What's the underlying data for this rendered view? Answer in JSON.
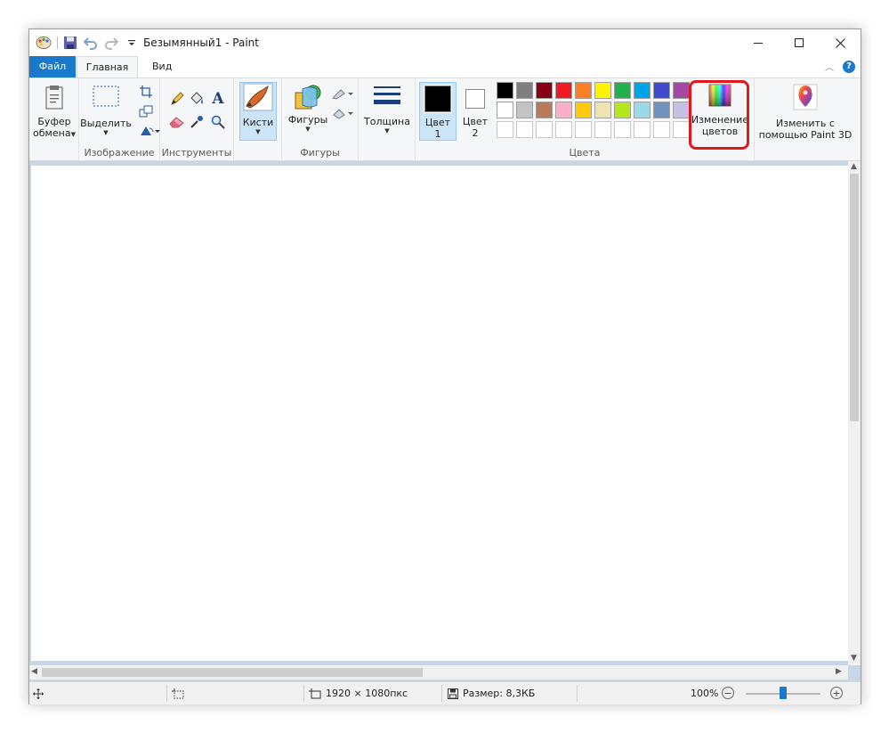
{
  "window": {
    "title": "Безымянный1 - Paint"
  },
  "tabs": {
    "file": "Файл",
    "home": "Главная",
    "view": "Вид"
  },
  "ribbon": {
    "clipboard": {
      "line1": "Буфер",
      "line2": "обмена"
    },
    "image": {
      "select_label": "Выделить",
      "group_label": "Изображение"
    },
    "tools": {
      "group_label": "Инструменты"
    },
    "brushes": {
      "label": "Кисти"
    },
    "shapes": {
      "label": "Фигуры",
      "group_label": "Фигуры"
    },
    "thickness": {
      "label": "Толщина"
    },
    "colors": {
      "color1_line1": "Цвет",
      "color1_line2": "1",
      "color2_line1": "Цвет",
      "color2_line2": "2",
      "group_label": "Цвета",
      "edit_line1": "Изменение",
      "edit_line2": "цветов",
      "palette_row1": [
        "#000000",
        "#7f7f7f",
        "#880015",
        "#ed1c24",
        "#ff7f27",
        "#fff200",
        "#22b14c",
        "#00a2e8",
        "#3f48cc",
        "#a349a4"
      ],
      "palette_row2": [
        "#ffffff",
        "#c3c3c3",
        "#b97a57",
        "#ffaec9",
        "#ffc90e",
        "#efe4b0",
        "#b5e61d",
        "#99d9ea",
        "#7092be",
        "#c8bfe7"
      ]
    },
    "paint3d": {
      "line1": "Изменить с",
      "line2": "помощью Paint 3D"
    }
  },
  "statusbar": {
    "dimensions": "1920 × 1080пкс",
    "size": "Размер: 8,3КБ",
    "zoom": "100%"
  }
}
